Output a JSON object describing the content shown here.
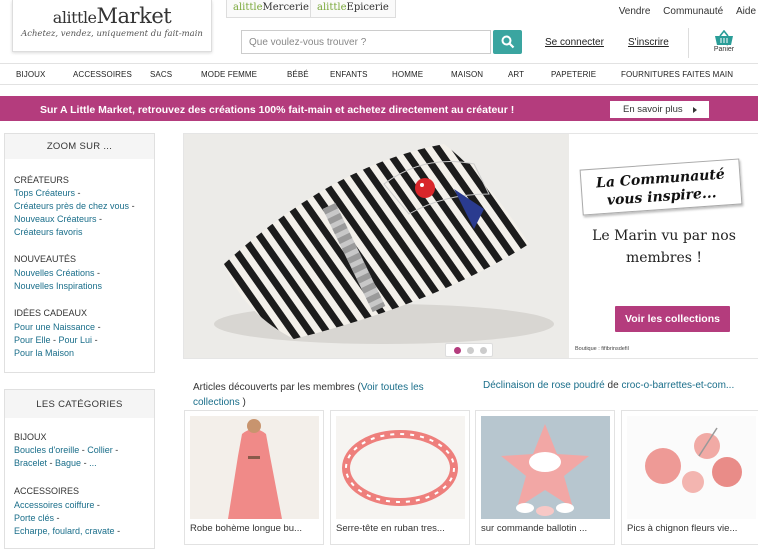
{
  "logo": {
    "brand_a": "a",
    "brand_little": "little",
    "brand_market": "Market",
    "tagline": "Achetez, vendez, uniquement du fait-main"
  },
  "subsites": [
    {
      "prefix": "alittle",
      "name": "Mercerie"
    },
    {
      "prefix": "alittle",
      "name": "Epicerie"
    }
  ],
  "toplinks": [
    "Vendre",
    "Communauté",
    "Aide"
  ],
  "search": {
    "placeholder": "Que voulez-vous trouver ?"
  },
  "account": {
    "login": "Se connecter",
    "signup": "S'inscrire",
    "cart": "Panier"
  },
  "nav": [
    "BIJOUX",
    "ACCESSOIRES",
    "SACS",
    "MODE FEMME",
    "BÉBÉ",
    "ENFANTS",
    "HOMME",
    "MAISON",
    "ART",
    "PAPETERIE",
    "FOURNITURES FAITES MAIN"
  ],
  "banner": {
    "text": "Sur A Little Market, retrouvez des créations 100% fait-main et achetez directement au créateur !",
    "button": "En savoir plus"
  },
  "sidebar_zoom": {
    "title": "ZOOM SUR ...",
    "sections": [
      {
        "heading": "CRÉATEURS",
        "links": [
          "Tops Créateurs",
          "Créateurs près de chez vous",
          "Nouveaux Créateurs",
          "Créateurs favoris"
        ]
      },
      {
        "heading": "NOUVEAUTÉS",
        "links": [
          "Nouvelles Créations",
          "Nouvelles Inspirations"
        ]
      },
      {
        "heading": "IDÉES CADEAUX",
        "links": [
          "Pour une Naissance",
          "Pour Elle",
          "Pour Lui",
          "Pour la Maison"
        ]
      }
    ]
  },
  "sidebar_categories": {
    "title": "LES CATÉGORIES",
    "sections": [
      {
        "heading": "BIJOUX",
        "links": [
          "Boucles d'oreille",
          "Collier",
          "Bracelet",
          "Bague",
          "..."
        ]
      },
      {
        "heading": "ACCESSOIRES",
        "links": [
          "Accessoires coiffure",
          "Porte clés",
          "Echarpe, foulard, cravate"
        ]
      }
    ]
  },
  "hero": {
    "tag_line1": "La Communauté",
    "tag_line2": "vous inspire...",
    "title": "Le Marin vu par nos membres !",
    "button": "Voir les collections",
    "credit": "Boutique : fifibrinsdefil",
    "slides": 3,
    "active_slide": 1
  },
  "articles": {
    "intro": "Articles découverts par les membres (",
    "link": "Voir toutes les collections",
    "close": ")",
    "collection_name": "Déclinaison de rose poudré",
    "by": "de",
    "collection_author": "croc-o-barrettes-et-com...",
    "items": [
      {
        "title": "Robe bohème longue bu..."
      },
      {
        "title": "Serre-tête en ruban tres..."
      },
      {
        "title": "sur commande ballotin ..."
      },
      {
        "title": "Pics à chignon fleurs vie..."
      }
    ]
  },
  "colors": {
    "accent": "#b43c7d",
    "search_button": "#3aa5a0",
    "link": "#1a6e8a"
  }
}
